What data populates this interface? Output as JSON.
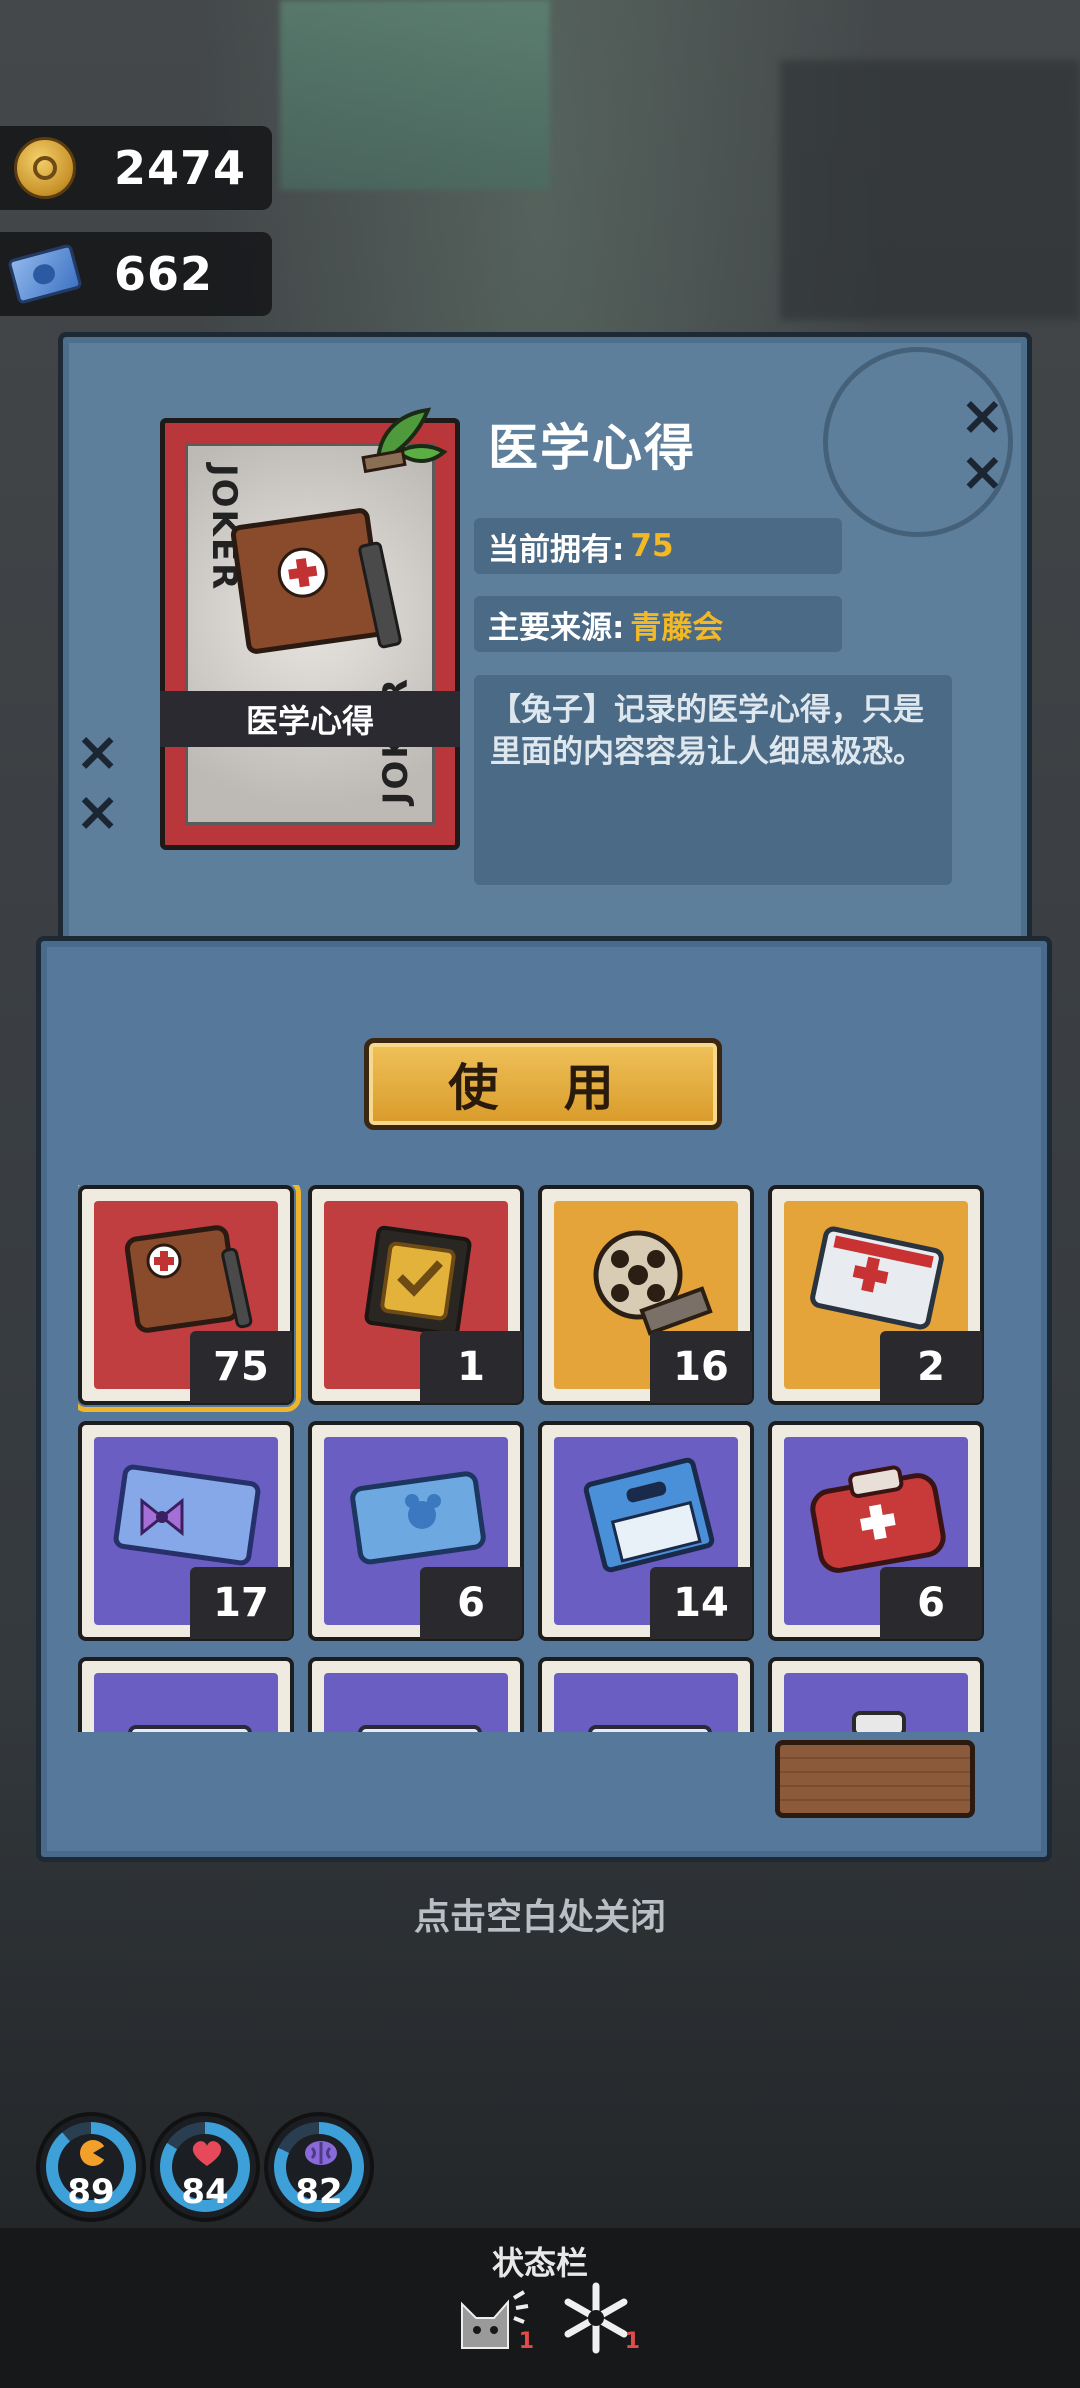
{
  "currency": {
    "coins": {
      "icon": "coin-icon",
      "value": "2474"
    },
    "tickets": {
      "icon": "ticket-icon",
      "value": "662"
    }
  },
  "item_detail": {
    "card_label": "医学心得",
    "card_corner_text": "JOKER",
    "title": "医学心得",
    "owned_label": "当前拥有:",
    "owned_value": "75",
    "source_label": "主要来源:",
    "source_value": "青藤会",
    "description": "【兔子】记录的医学心得，只是里面的内容容易让人细思极恐。"
  },
  "actions": {
    "use_label": "使 用"
  },
  "inventory": [
    {
      "icon": "notebook-icon",
      "bg": "red",
      "count": "75",
      "selected": true
    },
    {
      "icon": "gold-badge-icon",
      "bg": "red",
      "count": "1"
    },
    {
      "icon": "film-reel-icon",
      "bg": "orange",
      "count": "16"
    },
    {
      "icon": "medical-card-icon",
      "bg": "orange",
      "count": "2"
    },
    {
      "icon": "ticket-bow-icon",
      "bg": "purple",
      "count": "17"
    },
    {
      "icon": "blue-card-icon",
      "bg": "purple",
      "count": "6"
    },
    {
      "icon": "blue-booklet-icon",
      "bg": "purple",
      "count": "14"
    },
    {
      "icon": "first-aid-kit-icon",
      "bg": "purple",
      "count": "6"
    },
    {
      "icon": "partial-item-icon",
      "bg": "purple",
      "count": ""
    },
    {
      "icon": "partial-item-icon",
      "bg": "purple",
      "count": ""
    },
    {
      "icon": "partial-item-icon",
      "bg": "purple",
      "count": ""
    },
    {
      "icon": "bottle-icon",
      "bg": "purple",
      "count": ""
    }
  ],
  "close_hint": "点击空白处关闭",
  "gauges": [
    {
      "icon": "hunger-icon",
      "value": "89",
      "color": "#3da0d8"
    },
    {
      "icon": "heart-icon",
      "value": "84",
      "color": "#3da0d8"
    },
    {
      "icon": "brain-icon",
      "value": "82",
      "color": "#3da0d8"
    }
  ],
  "status_bar": {
    "label": "状态栏",
    "effects": [
      {
        "icon": "cat-icon",
        "count": "1"
      },
      {
        "icon": "snowflake-icon",
        "count": "1"
      }
    ]
  },
  "colors": {
    "accent": "#f2b826",
    "panel": "#5d7f9b",
    "card_red": "#b9363a"
  }
}
